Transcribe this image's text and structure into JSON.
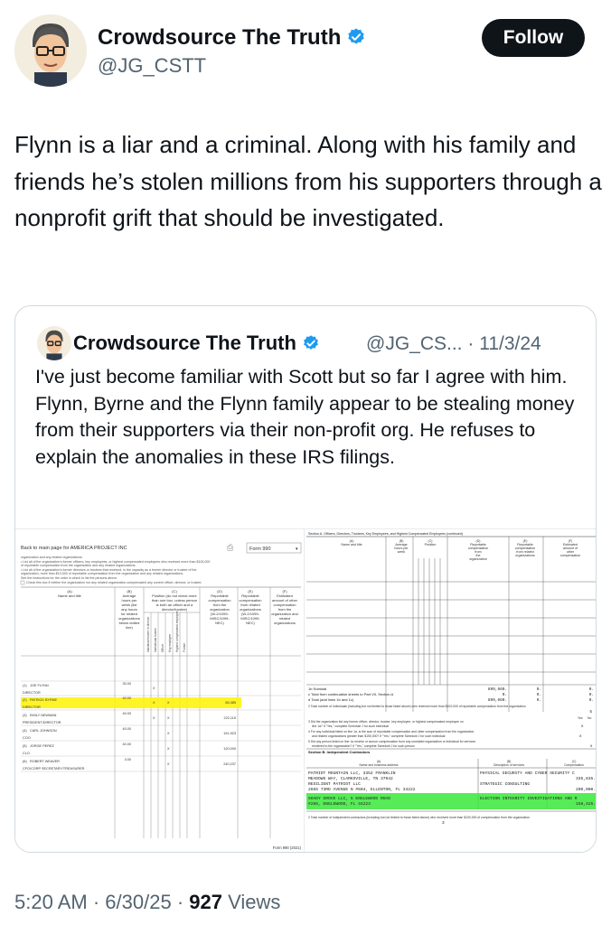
{
  "tweet": {
    "author_name": "Crowdsource The Truth",
    "author_handle": "@JG_CSTT",
    "follow_label": "Follow",
    "text": "Flynn is a liar and a criminal. Along with his family and friends he’s stolen millions from his supporters through a nonprofit grift that should be investigated.",
    "timestamp": "5:20 AM",
    "date": "6/30/25",
    "views_count": "927",
    "views_label": "Views",
    "separator": "·"
  },
  "quoted": {
    "author_name": "Crowdsource The Truth",
    "author_handle": "@JG_CS...",
    "date": "11/3/24",
    "separator": "·",
    "text": "I've just become familiar with Scott but so far I agree with him.  Flynn, Byrne and the Flynn family appear to be stealing money from their supporters via their non-profit org. He refuses to explain the anomalies in these IRS filings."
  },
  "doc_left": {
    "back_link": "Back to main page for AMERICA PROJECT INC",
    "form_select": "Form 990",
    "col_a": "(A) Name and title",
    "col_b": "(B) Average hours per week",
    "col_c": "(C) Position",
    "col_d": "(D) Reportable compensation from the organization",
    "col_e": "(E) Reportable compensation from related organizations",
    "col_f": "(F) Estimated amount of other compensation",
    "rows": [
      {
        "num": "(1)",
        "name": "JOE FLYNN",
        "title": "DIRECTOR",
        "hours": "30.00",
        "comp": ""
      },
      {
        "num": "(2)",
        "name": "PATRICK BYRNE",
        "title": "DIRECTOR",
        "hours": "40.00",
        "comp": "65,385"
      },
      {
        "num": "(3)",
        "name": "EMILY NEWMAN",
        "title": "PRESIDENT/DIRECTOR",
        "hours": "40.00",
        "comp": "222,115"
      },
      {
        "num": "(4)",
        "name": "CARL JOHNSON",
        "title": "COO",
        "hours": "40.00",
        "comp": "151,923"
      },
      {
        "num": "(5)",
        "name": "JORGE PEREZ",
        "title": "CLO",
        "hours": "40.00",
        "comp": "120,000"
      },
      {
        "num": "(6)",
        "name": "ROBERT WEAVER",
        "title": "CFO/CORP SECRETARY/TREASURER",
        "hours": "3.00",
        "comp": "240,237"
      }
    ],
    "footer": "Form 990 (2021)"
  },
  "doc_right": {
    "section_title": "Section A. Officers, Directors, Trustees, Key Employees, and Highest Compensated Employees (continued)",
    "subtotal_label": "1b Subtotal",
    "subtotal_value": "899,660.",
    "total_cont_label": "c Total from continuation sheets to Part VII, Section A",
    "total_cont_value": "0.",
    "total_label": "d Total (add lines 1b and 1c)",
    "total_value": "899,660.",
    "line2": "2 Total number of individuals (including but not limited to those listed above) who received more than $100,000 of reportable compensation from the organization",
    "line2_value": "5",
    "section_b": "Section B. Independent Contractors",
    "contractors": [
      {
        "name": "PATRIOT MOUNTAIN LLC, 3352 FRANKLIN",
        "addr": "MEADOWS WAY, CLARKSVILLE, TN 37042",
        "service": "PHYSICAL SECURITY AND CYBER SECURITY C",
        "comp": "335,835."
      },
      {
        "name": "RESILIENT PATRIOT LLC",
        "addr": "2655 73RD AVENUE N #604, ELLENTON, FL 34222",
        "service": "STRATEGIC CONSULTING",
        "comp": "200,000."
      },
      {
        "name": "SHADY GROVE LLC, 5 ENGLEWOOD ROAD",
        "addr": "#285, ENGLEWOOD, FL 34223",
        "service": "ELECTION INTEGRITY INVESTIGATIONS AND R",
        "comp": "158,425."
      }
    ],
    "line2b": "2 Total number of independent contractors (including but not limited to those listed above) who received more than $100,000 of compensation from the organization",
    "line2b_value": "3"
  }
}
